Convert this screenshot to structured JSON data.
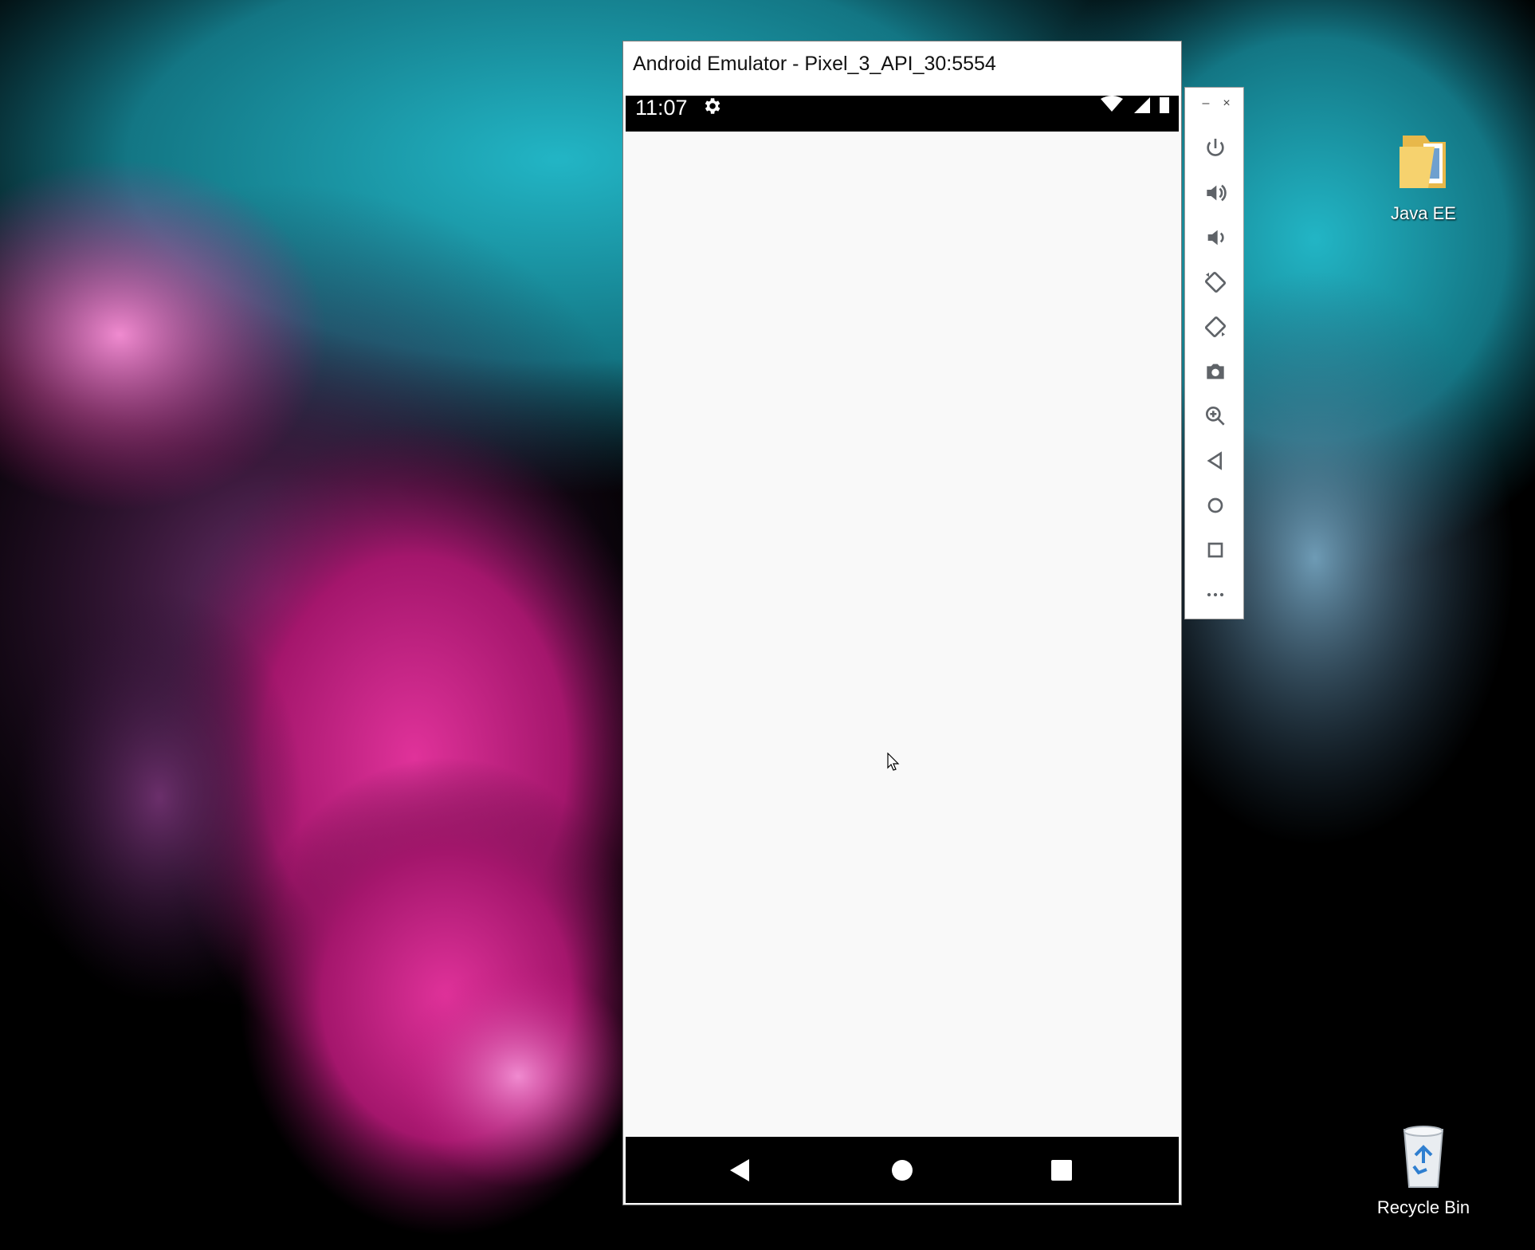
{
  "emulator": {
    "title": "Android Emulator - Pixel_3_API_30:5554",
    "status_bar": {
      "time": "11:07",
      "icons": [
        "gear-icon",
        "wifi-icon",
        "signal-icon",
        "battery-icon"
      ]
    },
    "nav_bar": {
      "buttons": [
        "back",
        "home",
        "recents"
      ]
    },
    "screen_background": "#f9f9f9"
  },
  "toolbar": {
    "minimize": "–",
    "close": "×",
    "buttons": [
      "power",
      "volume-up",
      "volume-down",
      "rotate-left",
      "rotate-right",
      "screenshot",
      "zoom",
      "back",
      "home",
      "overview",
      "more"
    ]
  },
  "desktop": {
    "icons": [
      {
        "label": "Java EE",
        "icon": "folder-icon"
      },
      {
        "label": "Recycle Bin",
        "icon": "recycle-bin-icon"
      }
    ]
  },
  "colors": {
    "wallpaper_teal": "#1a8a99",
    "wallpaper_pink": "#c2197f",
    "wallpaper_purple": "#5a2a5e",
    "wallpaper_black": "#000000"
  }
}
